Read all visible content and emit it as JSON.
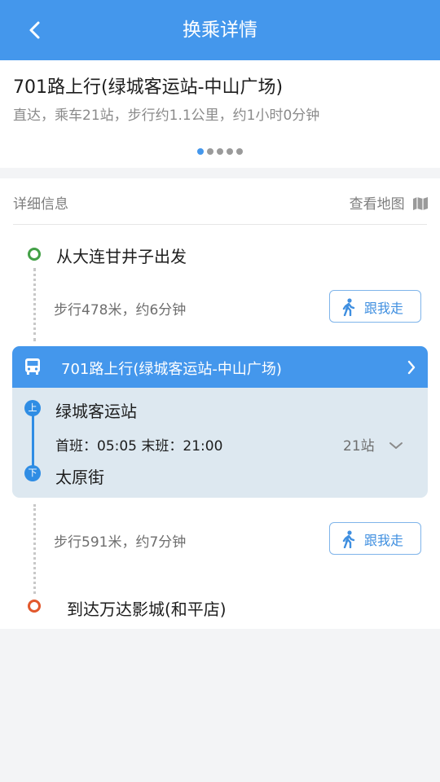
{
  "header": {
    "title": "换乘详情",
    "back_icon": "chevron-left-icon"
  },
  "summary": {
    "route_name": "701路上行(绿城客运站-中山广场)",
    "description": "直达，乘车21站，步行约1.1公里，约1小时0分钟",
    "pager": {
      "total": 5,
      "active": 1
    }
  },
  "detail": {
    "section_title": "详细信息",
    "map_link": "查看地图",
    "map_icon": "map-icon",
    "start": {
      "label": "从大连甘井子出发"
    },
    "walk1": {
      "text": "步行478米，约6分钟",
      "button": "跟我走"
    },
    "bus": {
      "name": "701路上行(绿城客运站-中山广场)",
      "board_badge": "上",
      "board_stop": "绿城客运站",
      "times": "首班：05:05 末班：21:00",
      "stop_count": "21站",
      "alight_badge": "下",
      "alight_stop": "太原街"
    },
    "walk2": {
      "text": "步行591米，约7分钟",
      "button": "跟我走"
    },
    "end": {
      "label": "到达万达影城(和平店)"
    }
  },
  "colors": {
    "primary": "#4497ec",
    "start_node": "#43a047",
    "end_node": "#e2582c",
    "bus_card_bg": "#dde8f0",
    "page_bg": "#f3f4f6"
  }
}
